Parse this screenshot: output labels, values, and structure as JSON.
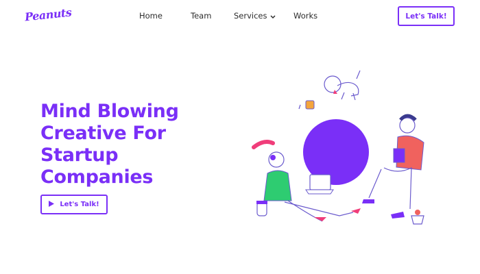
{
  "brand": {
    "logo_text": "Peanuts",
    "accent": "#7a2ff7"
  },
  "nav": {
    "items": [
      {
        "label": "Home"
      },
      {
        "label": "Team"
      },
      {
        "label": "Services"
      },
      {
        "label": "Works"
      }
    ],
    "cta_label": "Let's Talk!"
  },
  "hero": {
    "title_lines": [
      "Mind Blowing",
      "Creative For",
      "Startup",
      "Companies"
    ],
    "cta_label": "Let's Talk!",
    "cta_icon": "play-icon"
  },
  "illustration": {
    "name": "people-relaxing-illustration",
    "colors": {
      "planet": "#7a2ff7",
      "shirt_green": "#2ecc71",
      "shirt_red": "#f0625e",
      "hair_pink": "#f03d7a"
    }
  }
}
